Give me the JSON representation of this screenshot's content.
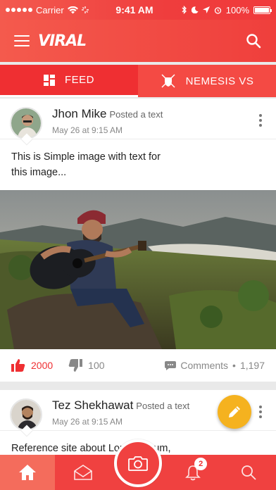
{
  "status_bar": {
    "carrier": "Carrier",
    "time": "9:41 AM",
    "battery": "100%",
    "battery_level": 1.0
  },
  "header": {
    "logo": "VIRAL",
    "menu_icon": "menu-icon",
    "search_icon": "search-icon"
  },
  "tabs": [
    {
      "label": "FEED",
      "icon": "grid-icon",
      "active": true
    },
    {
      "label": "NEMESIS VS",
      "icon": "shield-swords-icon",
      "active": false
    }
  ],
  "posts": [
    {
      "author": "Jhon Mike",
      "action": "Posted a text",
      "date": "May 26 at 9:15 AM",
      "text": "This is Simple image with text for this image...",
      "likes": "2000",
      "dislikes": "100",
      "comments_label": "Comments",
      "comments_count": "1,197"
    },
    {
      "author": "Tez Shekhawat",
      "action": "Posted a text",
      "date": "May 26 at 9:15 AM",
      "text": "Reference site about Lorem Ipsum,"
    }
  ],
  "bottom_nav": {
    "items": [
      "home-icon",
      "mail-icon",
      "camera-icon",
      "bell-icon",
      "search-icon"
    ],
    "notification_count": "2"
  },
  "colors": {
    "primary": "#ef3f3c",
    "fab": "#f5b21f",
    "like": "#ef2f32"
  }
}
